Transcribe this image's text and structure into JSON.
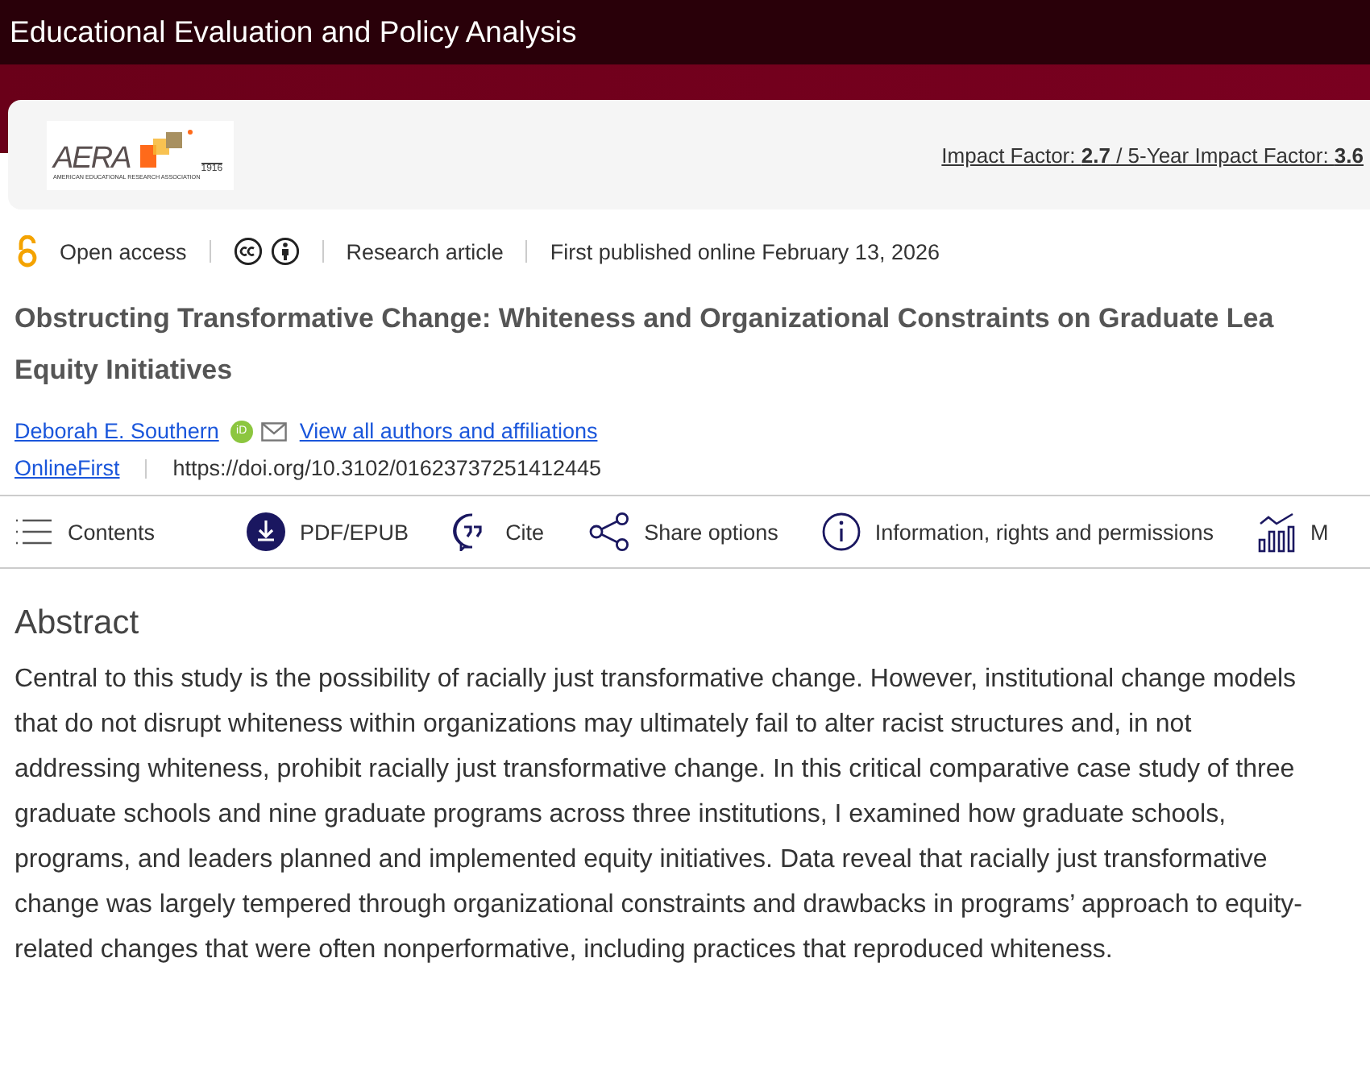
{
  "header": {
    "journal_title": "Educational Evaluation and Policy Analysis"
  },
  "banner": {
    "logo": {
      "wordmark": "AERA",
      "year": "1916",
      "subtitle": "AMERICAN EDUCATIONAL RESEARCH ASSOCIATION"
    },
    "impact": "Impact Factor: **2.7** / 5-Year Impact Factor: **3.6**"
  },
  "meta": {
    "access": "Open access",
    "article_type": "Research article",
    "published": "First published online February 13, 2026"
  },
  "article": {
    "title_lines": [
      "Obstructing Transformative Change: Whiteness and Organizational Constraints on Graduate Lea",
      "Equity Initiatives"
    ],
    "author": "Deborah E. Southern",
    "orcid": "iD",
    "authors_link": "View all authors and affiliations",
    "section": "OnlineFirst",
    "doi": "https://doi.org/10.3102/01623737251412445"
  },
  "toolbar": [
    {
      "kind": "contents",
      "label": "Contents"
    },
    {
      "kind": "pdf",
      "label": "PDF/EPUB"
    },
    {
      "kind": "cite",
      "label": "Cite"
    },
    {
      "kind": "share",
      "label": "Share options"
    },
    {
      "kind": "info",
      "label": "Information, rights and permissions"
    },
    {
      "kind": "metrics",
      "label": "M"
    }
  ],
  "abstract": {
    "heading": "Abstract",
    "text": "Central to this study is the possibility of racially just transformative change. However, institutional change models that do not disrupt whiteness within organizations may ultimately fail to alter racist structures and, in not addressing whiteness, prohibit racially just transformative change. In this critical comparative case study of three graduate schools and nine graduate programs across three institutions, I examined how graduate schools, programs, and leaders planned and implemented equity initiatives. Data reveal that racially just transformative change was largely tempered through organizational constraints and drawbacks in programs’ approach to equity-related changes that were often nonperformative, including practices that reproduced whiteness."
  }
}
